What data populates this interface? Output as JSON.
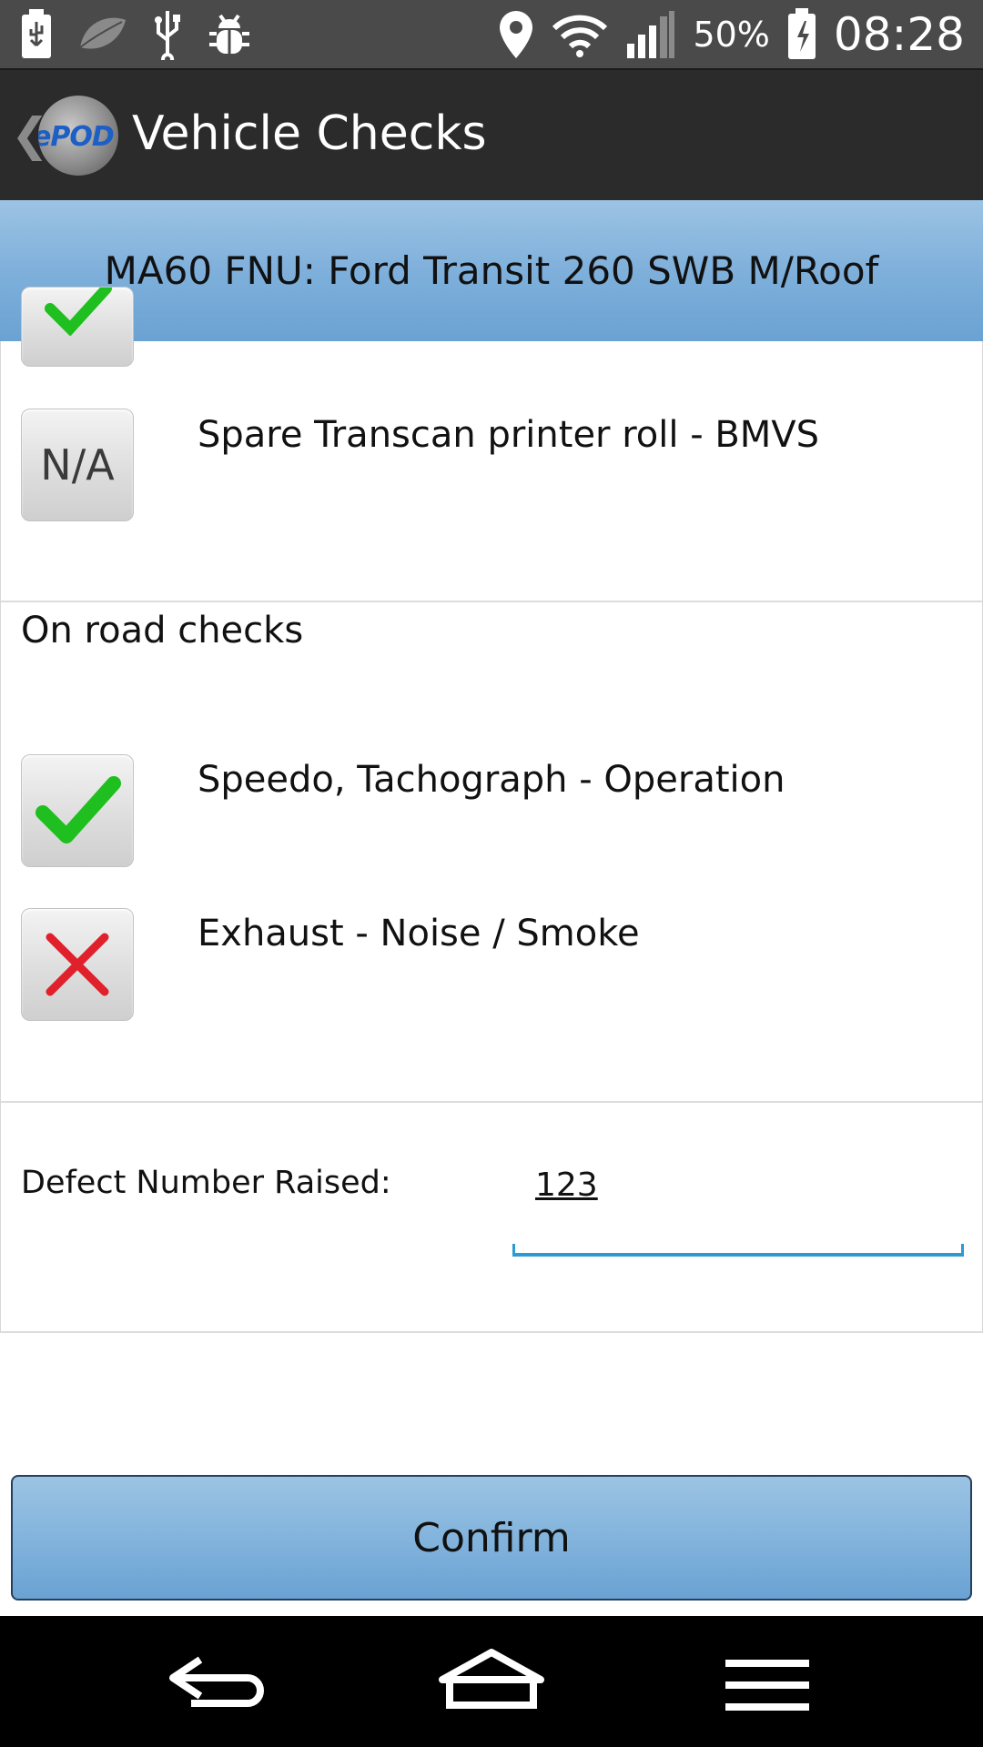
{
  "status_bar": {
    "battery_percent": "50%",
    "time": "08:28"
  },
  "action_bar": {
    "title": "Vehicle Checks",
    "logo_text": "ePOD"
  },
  "vehicle_header": {
    "text": "MA60 FNU: Ford Transit 260 SWB M/Roof"
  },
  "checks_top": [
    {
      "status": "N/A",
      "label": "Spare Transcan printer roll - BMVS"
    }
  ],
  "on_road": {
    "title": "On road checks",
    "items": [
      {
        "status": "pass",
        "label": "Speedo, Tachograph - Operation"
      },
      {
        "status": "fail",
        "label": "Exhaust - Noise / Smoke"
      }
    ]
  },
  "defect": {
    "label": "Defect Number Raised:",
    "value": "123"
  },
  "confirm_label": "Confirm",
  "colors": {
    "header_blue": "#7fb0db",
    "check_green": "#1fbf1f",
    "cross_red": "#e0202a",
    "input_accent": "#2d9ad4"
  }
}
